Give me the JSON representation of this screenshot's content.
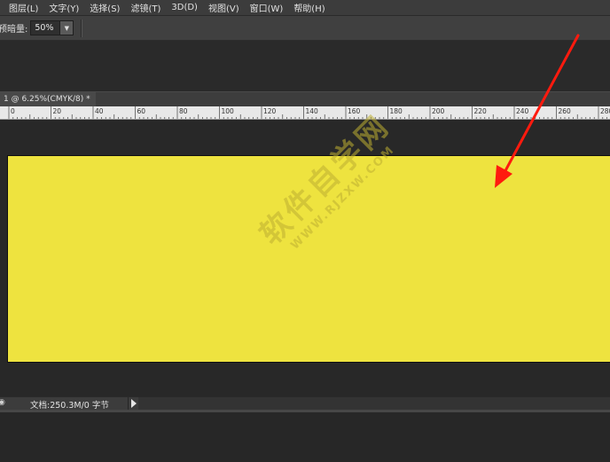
{
  "menu": [
    {
      "id": "image",
      "label": "图层(L)"
    },
    {
      "id": "type",
      "label": "文字(Y)"
    },
    {
      "id": "select",
      "label": "选择(S)"
    },
    {
      "id": "filter",
      "label": "滤镜(T)"
    },
    {
      "id": "3d",
      "label": "3D(D)"
    },
    {
      "id": "view",
      "label": "视图(V)"
    },
    {
      "id": "window",
      "label": "窗口(W)"
    },
    {
      "id": "help",
      "label": "帮助(H)"
    }
  ],
  "options": {
    "label": "预暗量:",
    "value": "50%"
  },
  "document_tab": {
    "title": "1 @ 6.25%(CMYK/8) *"
  },
  "ruler": {
    "labels": [
      "0",
      "20",
      "40",
      "60",
      "80",
      "100",
      "120",
      "140",
      "160",
      "180",
      "200",
      "220",
      "240",
      "260",
      "280"
    ]
  },
  "canvas": {
    "fill_color": "#eee33f",
    "background_color": "#282828"
  },
  "watermark": {
    "main": "软件自学网",
    "sub": "WWW.RJZXW.COM"
  },
  "annotation": {
    "color": "#ff1a0e"
  },
  "status": {
    "text": "文档:250.3M/0 字节"
  }
}
